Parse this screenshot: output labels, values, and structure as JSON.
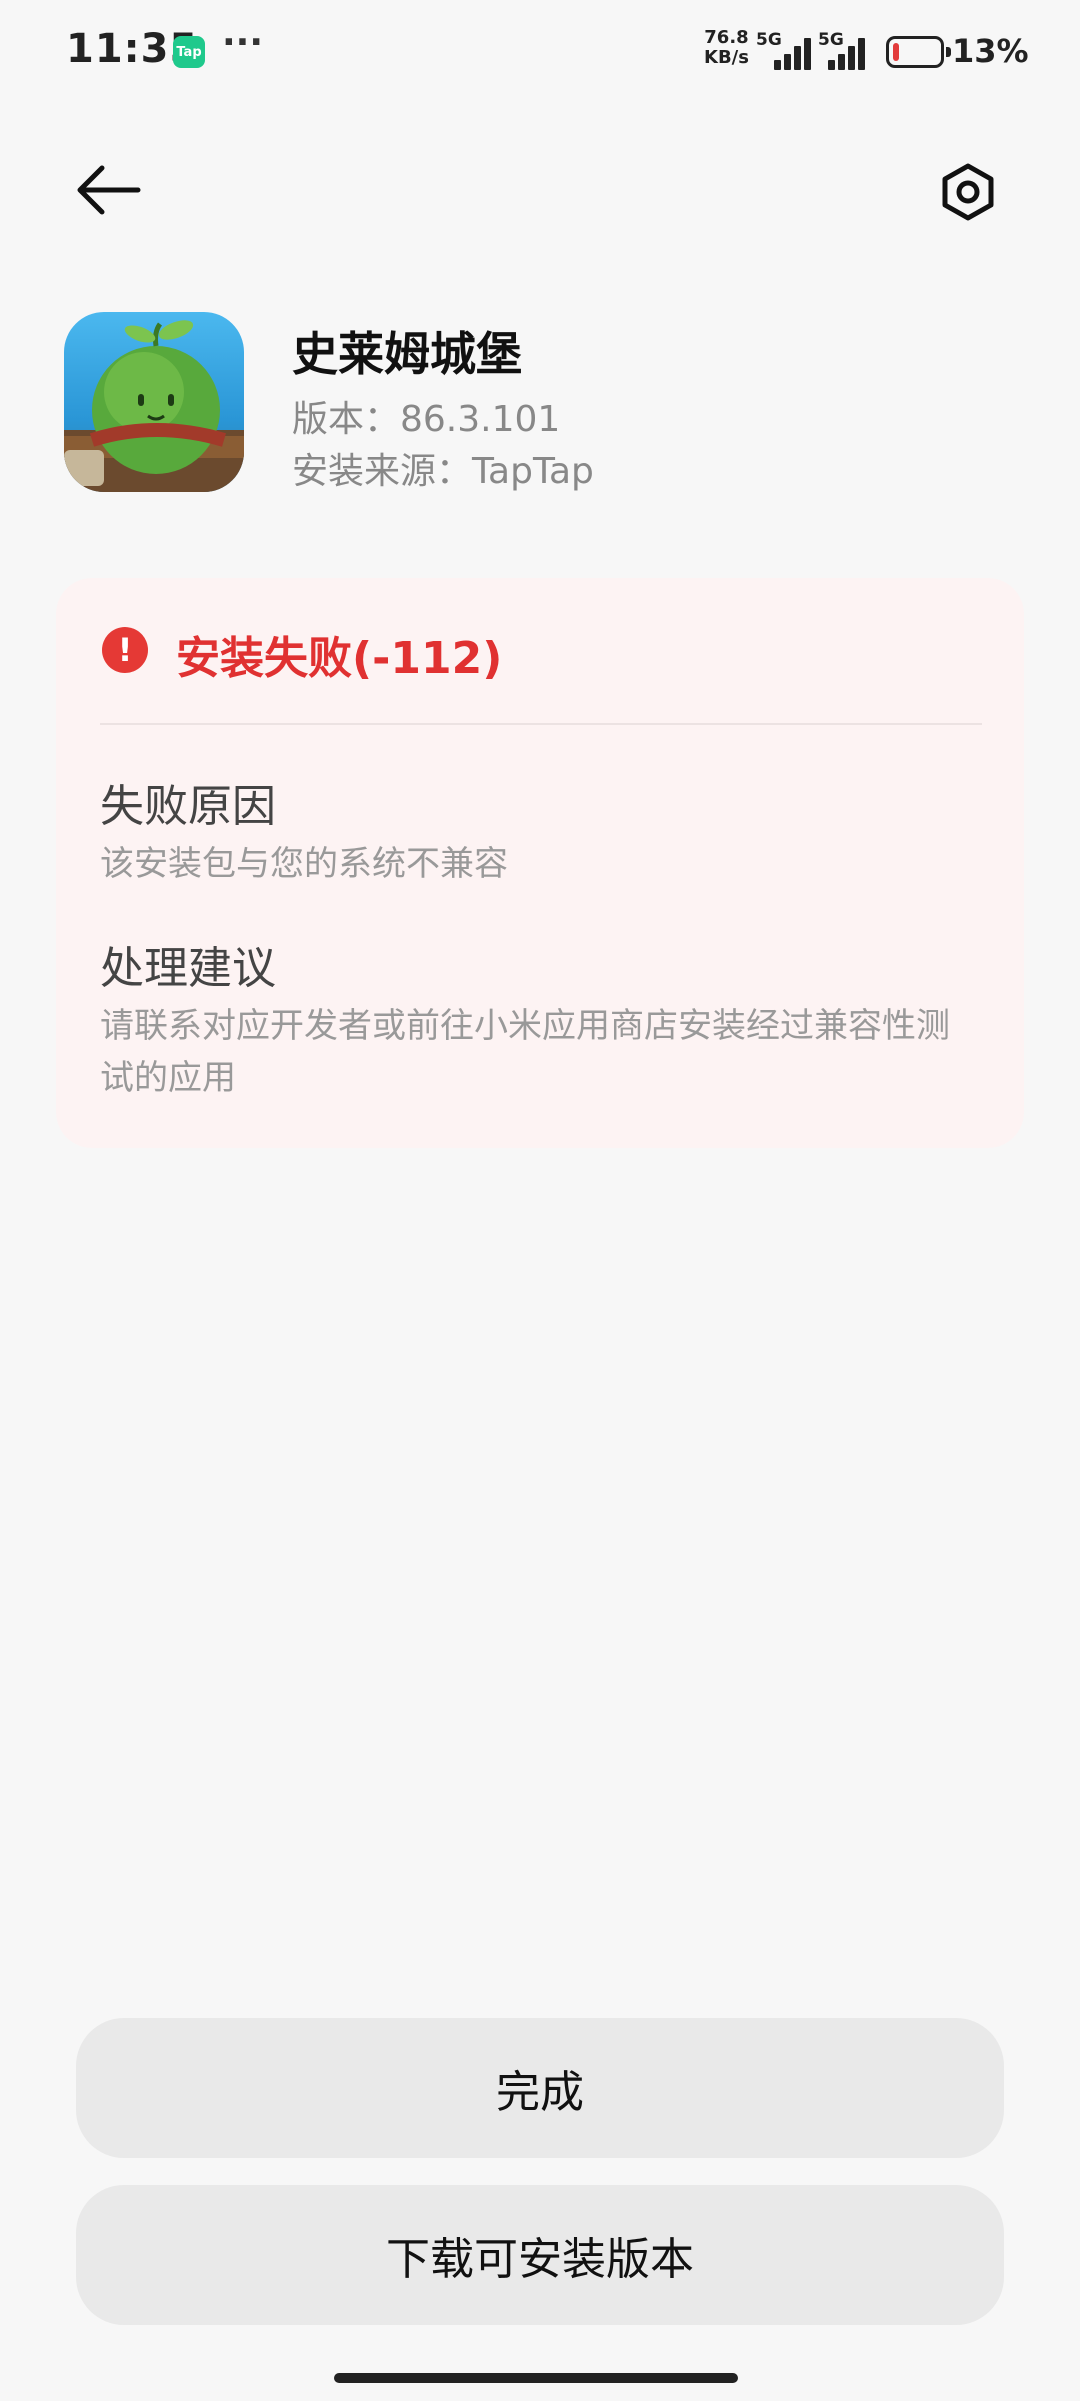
{
  "status_bar": {
    "time": "11:35",
    "app_badge": "Tap",
    "more": "···",
    "net_speed_value": "76.8",
    "net_speed_unit": "KB/s",
    "sim1": "5G",
    "sim2": "5G",
    "battery_percent": "13%",
    "battery_level": 0.13,
    "battery_color": "#e23b3b"
  },
  "header": {
    "back_icon": "arrow-left-icon",
    "settings_icon": "gear-icon"
  },
  "app": {
    "name": "史莱姆城堡",
    "version": "版本：86.3.101",
    "source": "安装来源：TapTap"
  },
  "error": {
    "icon": "exclamation-circle-icon",
    "title": "安装失败(-112)",
    "reason_title": "失败原因",
    "reason_body": "该安装包与您的系统不兼容",
    "suggestion_title": "处理建议",
    "suggestion_body": "请联系对应开发者或前往小米应用商店安装经过兼容性测试的应用",
    "accent_color": "#e03131"
  },
  "buttons": {
    "done": "完成",
    "download": "下载可安装版本"
  }
}
